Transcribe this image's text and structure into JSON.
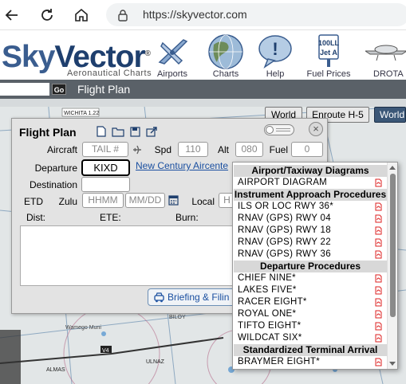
{
  "browser": {
    "url": "https://skyvector.com"
  },
  "site": {
    "logo_sky": "Sky",
    "logo_vector": "Vector",
    "logo_registered": "®",
    "tagline": "Aeronautical Charts",
    "nav": [
      {
        "label": "Airports",
        "icon": "airplane-icon"
      },
      {
        "label": "Charts",
        "icon": "globe-icon"
      },
      {
        "label": "Help",
        "icon": "help-bubble-icon"
      },
      {
        "label": "Fuel Prices",
        "icon": "fuel-sign-icon",
        "sign_line1": "100LL",
        "sign_line2": "Jet A"
      },
      {
        "label": "DROTA",
        "icon": "drone-icon"
      }
    ]
  },
  "toolbar": {
    "go_label": "Go",
    "flight_plan_label": "Flight Plan"
  },
  "chart_buttons": [
    "World Hi",
    "Enroute H-5",
    "World"
  ],
  "map_labels": {
    "wichita": "WICHITA 1.22",
    "biloy": "BILOY",
    "wamego": "Wamego Muni",
    "ulnaz": "ULNAZ",
    "almas": "ALMAS",
    "v4": "V4"
  },
  "flight_plan": {
    "title": "Flight Plan",
    "aircraft_label": "Aircraft",
    "aircraft_placeholder": "TAIL #",
    "spd_label": "Spd",
    "spd_value": "110",
    "alt_label": "Alt",
    "alt_value": "080",
    "fuel_label": "Fuel",
    "fuel_value": "0",
    "departure_label": "Departure",
    "departure_value": "KIXD",
    "departure_link": "New Century Aircente",
    "destination_label": "Destination",
    "etd_label": "ETD",
    "zulu_label": "Zulu",
    "zulu_placeholder": "HHMM",
    "date_placeholder": "MM/DD",
    "local_label": "Local",
    "local_placeholder": "H",
    "dist_label": "Dist:",
    "ete_label": "ETE:",
    "burn_label": "Burn:",
    "briefing_label": "Briefing & Filin"
  },
  "procedures": {
    "sections": [
      {
        "title": "Airport/Taxiway Diagrams",
        "items": [
          "AIRPORT DIAGRAM"
        ]
      },
      {
        "title": "Instrument Approach Procedures",
        "items": [
          "ILS OR LOC RWY 36*",
          "RNAV (GPS) RWY 04",
          "RNAV (GPS) RWY 18",
          "RNAV (GPS) RWY 22",
          "RNAV (GPS) RWY 36"
        ]
      },
      {
        "title": "Departure Procedures",
        "items": [
          "CHIEF NINE*",
          "LAKES FIVE*",
          "RACER EIGHT*",
          "ROYAL ONE*",
          "TIFTO EIGHT*",
          "WILDCAT SIX*"
        ]
      },
      {
        "title": "Standardized Terminal Arrival",
        "items": [
          "BRAYMER EIGHT*"
        ]
      }
    ]
  },
  "colors": {
    "accent_blue": "#1a4fa0",
    "pdf_red": "#d22",
    "toolbar_gray": "#5a6168"
  }
}
